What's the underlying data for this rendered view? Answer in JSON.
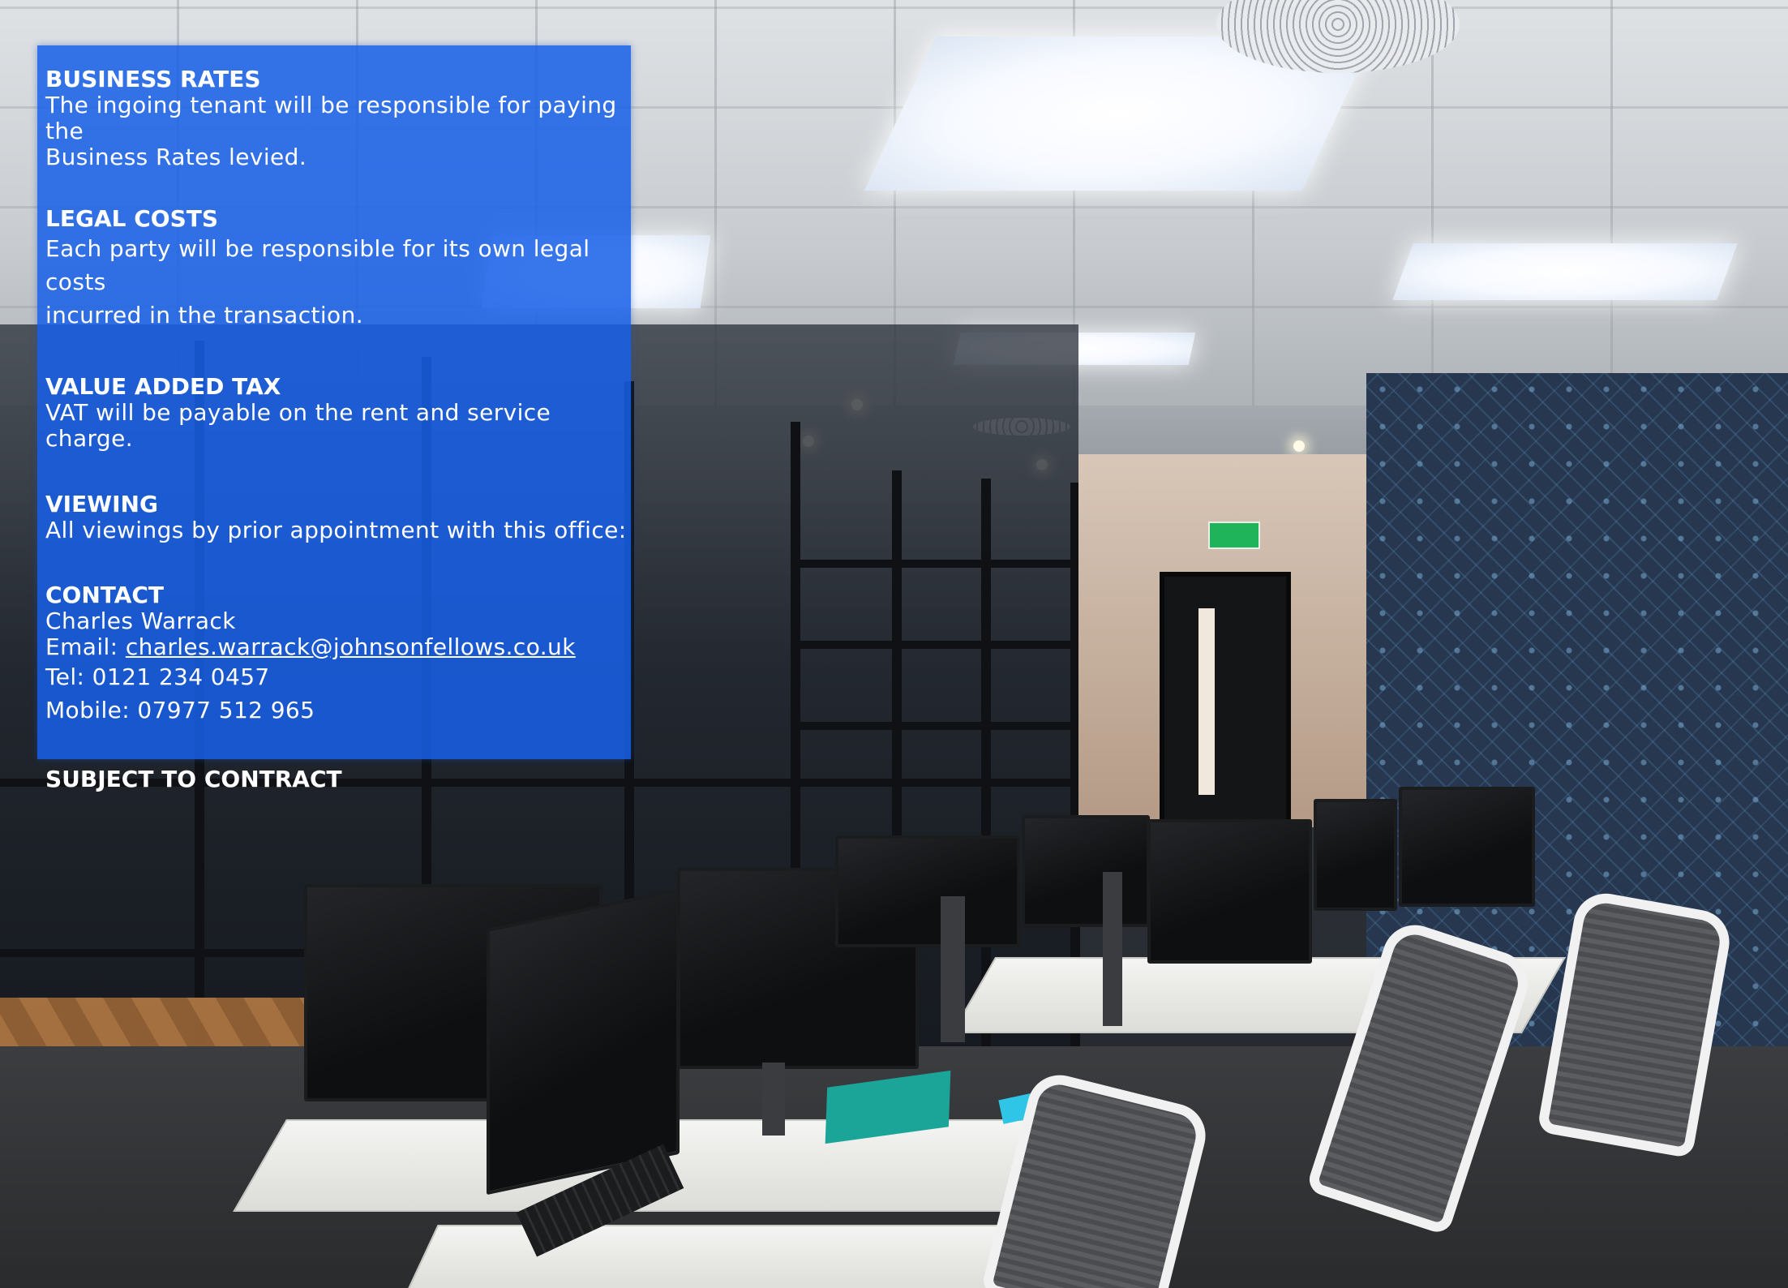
{
  "business_rates": {
    "heading": "BUSINESS RATES",
    "lines": [
      "The ingoing tenant will be responsible for paying the",
      "Business Rates levied."
    ]
  },
  "legal_costs": {
    "heading": "LEGAL COSTS",
    "lines": [
      "Each party will be responsible for its own legal costs",
      "incurred in the transaction."
    ]
  },
  "vat": {
    "heading": "VALUE ADDED TAX",
    "lines": [
      "VAT will be payable on the rent and service charge."
    ]
  },
  "viewing": {
    "heading": "VIEWING",
    "lines": [
      "All viewings by prior appointment with this office:"
    ]
  },
  "contact": {
    "heading": "CONTACT",
    "name": "Charles Warrack",
    "email_label": "Email: ",
    "email": "charles.warrack@johnsonfellows.co.uk",
    "tel": "Tel: 0121 234 0457",
    "mobile": "Mobile: 07977 512 965"
  },
  "footer": {
    "subject_to_contract": "SUBJECT TO CONTRACT"
  },
  "colors": {
    "panel_blue": "#1760e8",
    "text": "#ffffff"
  },
  "background_photo": {
    "description_icon": "office-photo"
  }
}
